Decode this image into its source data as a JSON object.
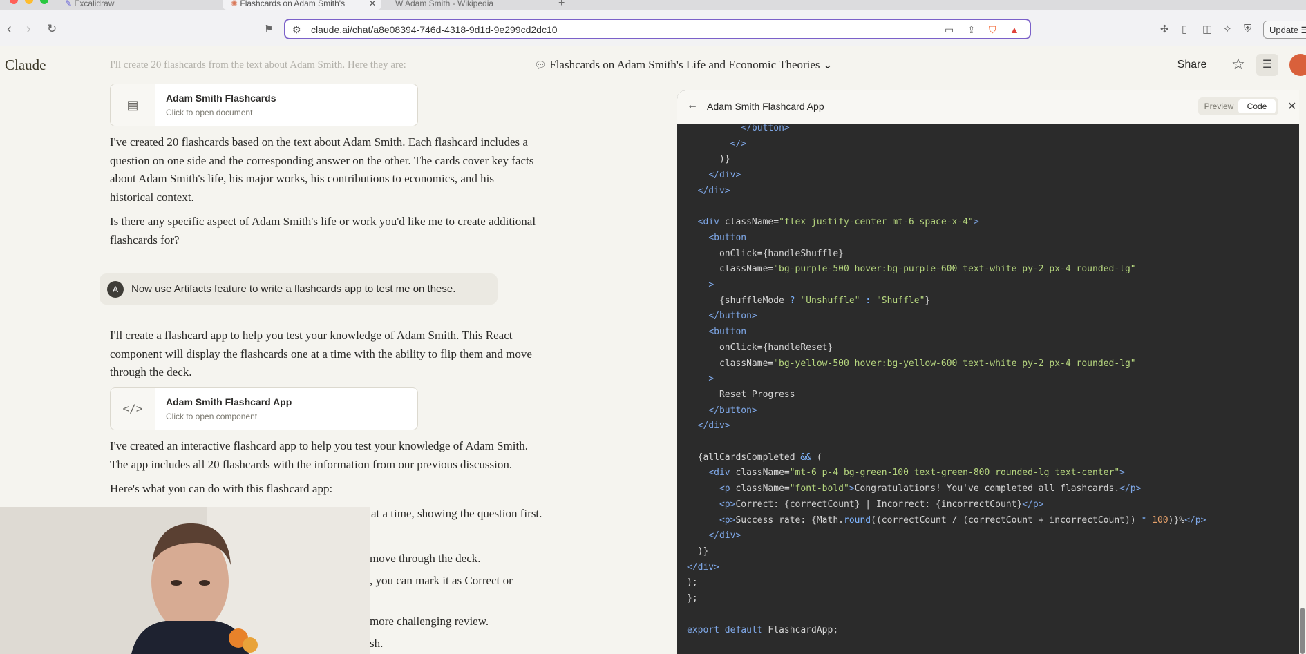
{
  "browser": {
    "tabs": [
      {
        "label": "Excalidraw",
        "active": false
      },
      {
        "label": "Flashcards on Adam Smith's",
        "active": true
      },
      {
        "label": "Adam Smith - Wikipedia",
        "active": false
      }
    ],
    "new_tab": "+",
    "url": "claude.ai/chat/a8e08394-746d-4318-9d1d-9e299cd2dc10",
    "update_label": "Update ☰"
  },
  "header": {
    "logo": "Claude",
    "conversation_title": "Flashcards on Adam Smith's Life and Economic Theories ⌄",
    "share_label": "Share"
  },
  "chat": {
    "top_cut_text": "I'll create 20 flashcards from the text about Adam Smith. Here they are:",
    "card1": {
      "title": "Adam Smith Flashcards",
      "subtitle": "Click to open document"
    },
    "para1_l1": "I've created 20 flashcards based on the text about Adam Smith. Each flashcard includes a",
    "para1_l2": "question on one side and the corresponding answer on the other. The cards cover key facts",
    "para1_l3": "about Adam Smith's life, his major works, his contributions to economics, and his",
    "para1_l4": "historical context.",
    "para2_l1": "Is there any specific aspect of Adam Smith's life or work you'd like me to create additional",
    "para2_l2": "flashcards for?",
    "user_initial": "A",
    "user_message": "Now use Artifacts feature to write a flashcards app to test me on these.",
    "para3_l1": "I'll create a flashcard app to help you test your knowledge of Adam Smith. This React",
    "para3_l2": "component will display the flashcards one at a time with the ability to flip them and move",
    "para3_l3": "through the deck.",
    "card2": {
      "title": "Adam Smith Flashcard App",
      "subtitle": "Click to open component"
    },
    "para4_l1": "I've created an interactive flashcard app to help you test your knowledge of Adam Smith.",
    "para4_l2": "The app includes all 20 flashcards with the information from our previous discussion.",
    "para5": "Here's what you can do with this flashcard app:",
    "frag1": "at a time, showing the question first.",
    "frag2": "move through the deck.",
    "frag3": ", you can mark it as Correct or",
    "frag4": "more challenging review.",
    "frag5": "sh."
  },
  "artifact": {
    "title": "Adam Smith Flashcard App",
    "preview_label": "Preview",
    "code_label": "Code"
  },
  "colors": {
    "accent": "#7b61c9",
    "code_bg": "#2b2b2b",
    "page_bg": "#f5f4ef"
  }
}
